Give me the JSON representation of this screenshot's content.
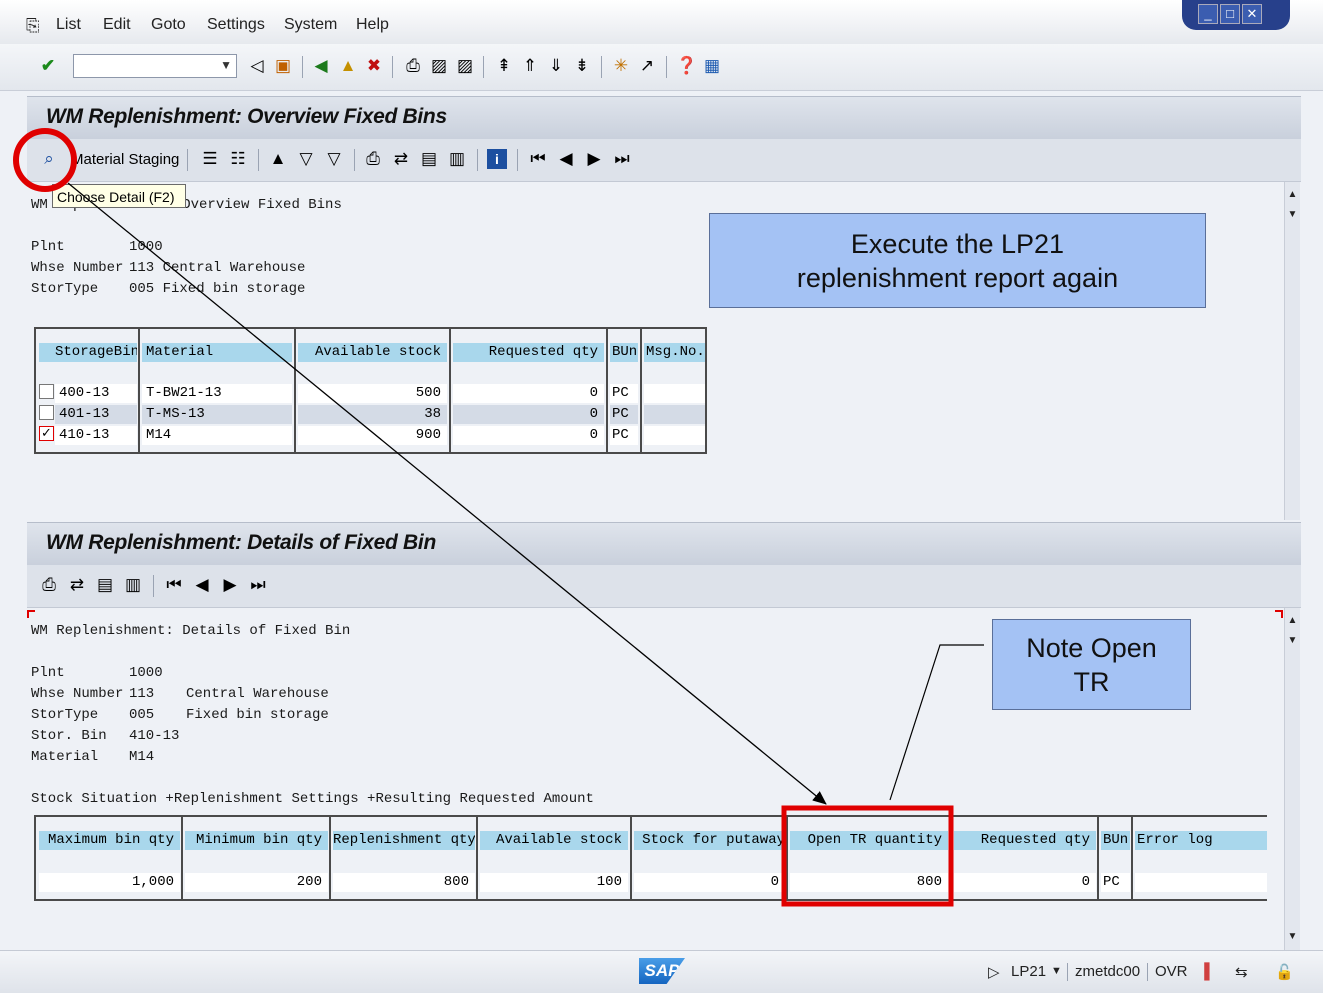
{
  "menu": {
    "items": [
      "List",
      "Edit",
      "Goto",
      "Settings",
      "System",
      "Help"
    ]
  },
  "top_pane": {
    "title": "WM Replenishment: Overview Fixed Bins",
    "toolbar": {
      "material_staging_label": "Material Staging"
    },
    "tooltip": "Choose Detail   (F2)",
    "report_heading": "WM Replenishment: Overview Fixed Bins",
    "header": {
      "plnt_label": "Plnt",
      "plnt_value": "1000",
      "whse_label": "Whse Number",
      "whse_value": "113 Central Warehouse",
      "stortype_label": "StorType",
      "stortype_value": "005 Fixed bin storage"
    },
    "table": {
      "columns": [
        "StorageBin",
        "Material",
        "Available stock",
        "Requested qty",
        "BUn",
        "Msg.No."
      ],
      "rows": [
        {
          "bin": "400-13",
          "material": "T-BW21-13",
          "available": "500",
          "requested": "0",
          "bun": "PC",
          "msg": "",
          "checked": false
        },
        {
          "bin": "401-13",
          "material": "T-MS-13",
          "available": "38",
          "requested": "0",
          "bun": "PC",
          "msg": "",
          "checked": false
        },
        {
          "bin": "410-13",
          "material": "M14",
          "available": "900",
          "requested": "0",
          "bun": "PC",
          "msg": "",
          "checked": true
        }
      ]
    }
  },
  "bottom_pane": {
    "title": "WM Replenishment: Details of Fixed Bin",
    "report_heading": "WM Replenishment: Details of Fixed Bin",
    "header": {
      "plnt_label": "Plnt",
      "plnt_value": "1000",
      "whse_label": "Whse Number",
      "whse_value": "113",
      "whse_desc": "Central Warehouse",
      "stortype_label": "StorType",
      "stortype_value": "005",
      "stortype_desc": "Fixed bin storage",
      "storbin_label": "Stor. Bin",
      "storbin_value": "410-13",
      "material_label": "Material",
      "material_value": "M14"
    },
    "section_label": "Stock Situation +Replenishment Settings +Resulting Requested Amount",
    "table": {
      "columns": [
        "Maximum bin qty",
        "Minimum bin qty",
        "Replenishment qty",
        "Available stock",
        "Stock for putaway",
        "Open TR quantity",
        "Requested qty",
        "BUn",
        "Error log"
      ],
      "row": [
        "1,000",
        "200",
        "800",
        "100",
        "0",
        "800",
        "0",
        "PC",
        ""
      ]
    }
  },
  "callouts": {
    "execute_line1": "Execute the LP21",
    "execute_line2": "replenishment report again",
    "note_line1": "Note Open",
    "note_line2": "TR"
  },
  "status": {
    "transaction": "LP21",
    "server": "zmetdc00",
    "mode": "OVR",
    "logo": "SAP"
  },
  "colors": {
    "callout_fill": "#a4c2f4",
    "highlight_red": "#e00000",
    "header_cell": "#a9d7ec"
  }
}
